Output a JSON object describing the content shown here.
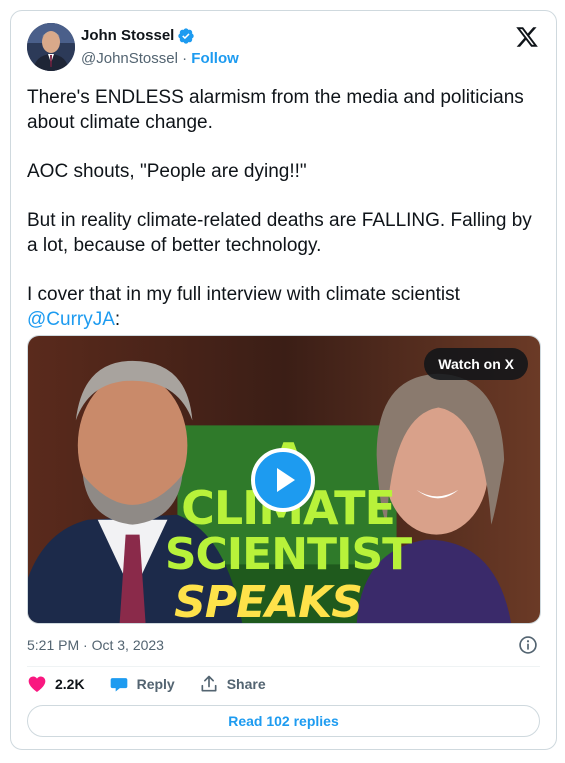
{
  "author": {
    "name": "John Stossel",
    "handle": "@JohnStossel",
    "separator": "·",
    "follow_label": "Follow"
  },
  "tweet": {
    "paragraphs": [
      "There's ENDLESS alarmism from the media and politicians about climate change.",
      "AOC shouts, \"People are dying!!\"",
      "But in reality climate-related deaths are FALLING.  Falling by a lot, because of better technology."
    ],
    "last_paragraph_prefix": "I cover that in my full interview with climate scientist ",
    "mention": "@CurryJA",
    "last_paragraph_suffix": ":"
  },
  "media": {
    "watch_label": "Watch on X",
    "thumbnail_text": [
      "A CLIMATE",
      "SCIENTIST",
      "SPEAKS OUT"
    ]
  },
  "meta": {
    "timestamp": "5:21 PM · Oct 3, 2023"
  },
  "actions": {
    "likes": "2.2K",
    "reply_label": "Reply",
    "share_label": "Share"
  },
  "footer": {
    "read_replies_label": "Read 102 replies"
  },
  "colors": {
    "accent": "#1d9bf0",
    "like": "#f91880",
    "text": "#0f1419",
    "muted": "#536471"
  },
  "icons": [
    "verified-badge-icon",
    "x-logo-icon",
    "play-icon",
    "info-icon",
    "heart-icon",
    "reply-bubble-icon",
    "share-icon"
  ]
}
